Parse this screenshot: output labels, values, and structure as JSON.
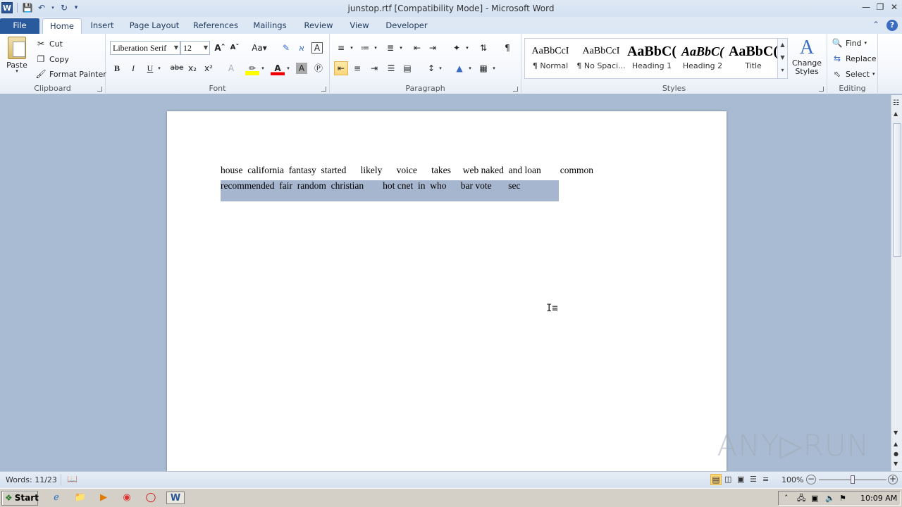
{
  "title": "junstop.rtf [Compatibility Mode]  -  Microsoft Word",
  "tabs": [
    "File",
    "Home",
    "Insert",
    "Page Layout",
    "References",
    "Mailings",
    "Review",
    "View",
    "Developer"
  ],
  "clipboard": {
    "paste": "Paste",
    "cut": "Cut",
    "copy": "Copy",
    "format_painter": "Format Painter",
    "label": "Clipboard"
  },
  "font": {
    "name": "Liberation Serif",
    "size": "12",
    "label": "Font",
    "bold": "B",
    "italic": "I",
    "underline": "U",
    "strike": "abe",
    "sub": "x₂",
    "sup": "x²"
  },
  "paragraph": {
    "label": "Paragraph",
    "pilcrow": "¶"
  },
  "styles": {
    "label": "Styles",
    "items": [
      {
        "preview": "AaBbCcI",
        "name": "¶ Normal"
      },
      {
        "preview": "AaBbCcI",
        "name": "¶ No Spaci..."
      },
      {
        "preview": "AaBbC(",
        "name": "Heading 1"
      },
      {
        "preview": "AaBbC(",
        "name": "Heading 2"
      },
      {
        "preview": "AaBbC(",
        "name": "Title"
      }
    ],
    "change_styles": "Change Styles"
  },
  "editing": {
    "label": "Editing",
    "find": "Find",
    "replace": "Replace",
    "select": "Select"
  },
  "document": {
    "line1": "house  california  fantasy  started      likely      voice      takes     web naked  and loan        common",
    "line2": "recommended  fair  random  christian        hot cnet  in  who      bar vote       sec"
  },
  "status": {
    "words": "Words: 11/23",
    "zoom": "100%"
  },
  "taskbar": {
    "start": "Start",
    "clock": "10:09 AM"
  },
  "watermark": "ANY▷RUN"
}
